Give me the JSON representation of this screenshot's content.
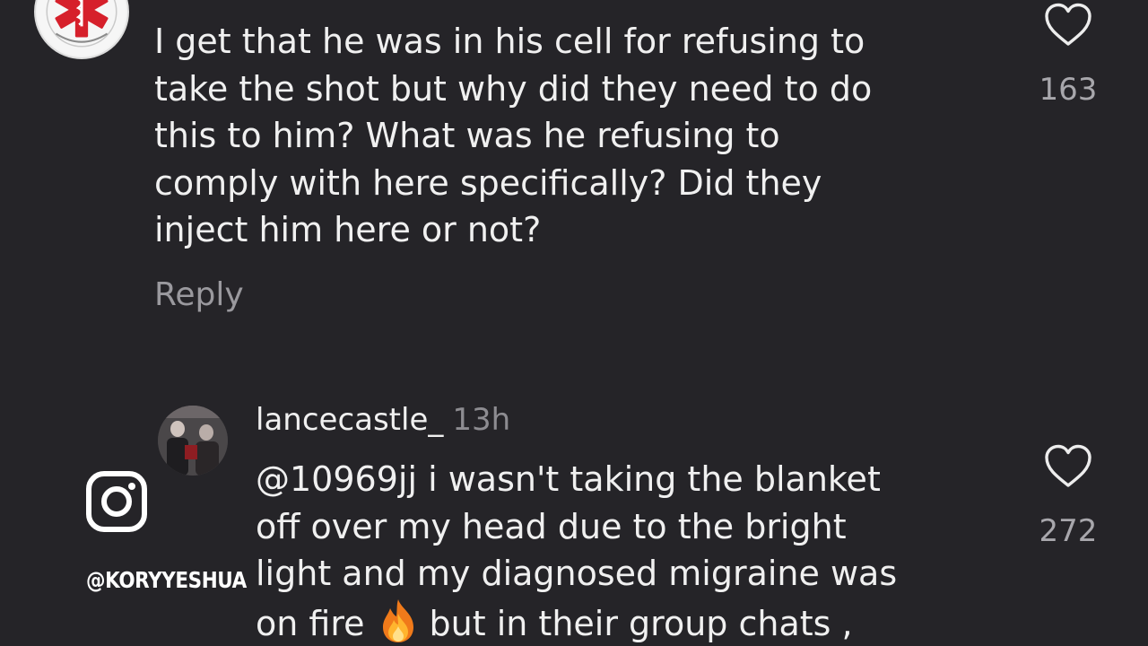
{
  "comment_1": {
    "text": "I get that he was in his cell for refusing to\ntake the shot but why did they need to do\nthis to him? What was he refusing to\ncomply with here specifically? Did they\ninject him here or not?",
    "reply_label": "Reply",
    "like_count": "163",
    "avatar_icon": "ambulance-star-of-life-icon",
    "like_icon": "heart-outline-icon"
  },
  "comment_2": {
    "username": "lancecastle_",
    "timestamp": "13h",
    "text_before_emoji": "@10969jj i wasn't  taking the blanket\noff over my head due to the bright\nlight and my diagnosed migraine was\non fire",
    "text_after_emoji": "but in their group chats ,",
    "emoji_icon": "fire-icon",
    "like_count": "272",
    "like_icon": "heart-outline-icon"
  },
  "watermark": {
    "icon": "instagram-icon",
    "handle": "@KORYYESHUA"
  },
  "colors": {
    "background": "#252428",
    "text": "#f0f0f0",
    "muted": "#9a999e",
    "timestamp": "#8d8c91"
  }
}
